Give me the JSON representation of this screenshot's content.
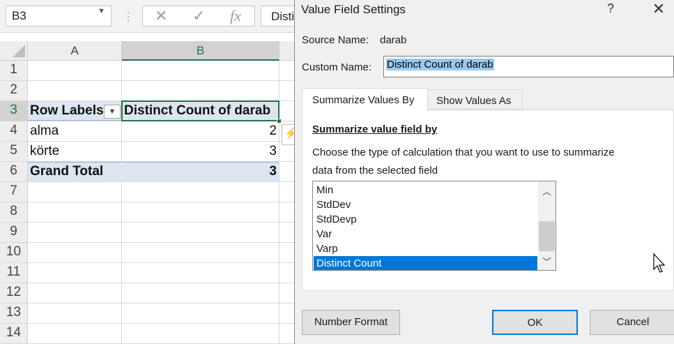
{
  "excel": {
    "name_box": "B3",
    "formula_bar_text": "Distinct Count of darab",
    "fx_label": "fx",
    "columns": [
      "A",
      "B"
    ],
    "rows": [
      "1",
      "2",
      "3",
      "4",
      "5",
      "6",
      "7",
      "8",
      "9",
      "10",
      "11",
      "12",
      "13",
      "14"
    ],
    "pivot": {
      "header_row_labels": "Row Labels",
      "header_value": "Distinct Count of darab",
      "items": [
        {
          "label": "alma",
          "value": "2"
        },
        {
          "label": "körte",
          "value": "3"
        }
      ],
      "grand_total_label": "Grand Total",
      "grand_total_value": "3"
    }
  },
  "dialog": {
    "title": "Value Field Settings",
    "help": "?",
    "close": "✕",
    "source_name_label": "Source Name:",
    "source_name_value": "darab",
    "custom_name_label": "Custom Name:",
    "custom_name_value": "Distinct Count of darab",
    "tabs": [
      {
        "label": "Summarize Values By",
        "active": true
      },
      {
        "label": "Show Values As",
        "active": false
      }
    ],
    "section_title": "Summarize value field by",
    "description_line1": "Choose the type of calculation that you want to use to summarize",
    "description_line2": "data from the selected field",
    "functions": [
      "Min",
      "StdDev",
      "StdDevp",
      "Var",
      "Varp",
      "Distinct Count"
    ],
    "selected_function": "Distinct Count",
    "buttons": {
      "number_format": "Number Format",
      "ok": "OK",
      "cancel": "Cancel"
    }
  },
  "colors": {
    "excel_green": "#217346",
    "pivot_band": "#dce6f1",
    "selection_blue": "#0078d7",
    "text_highlight": "#99c9ef"
  }
}
